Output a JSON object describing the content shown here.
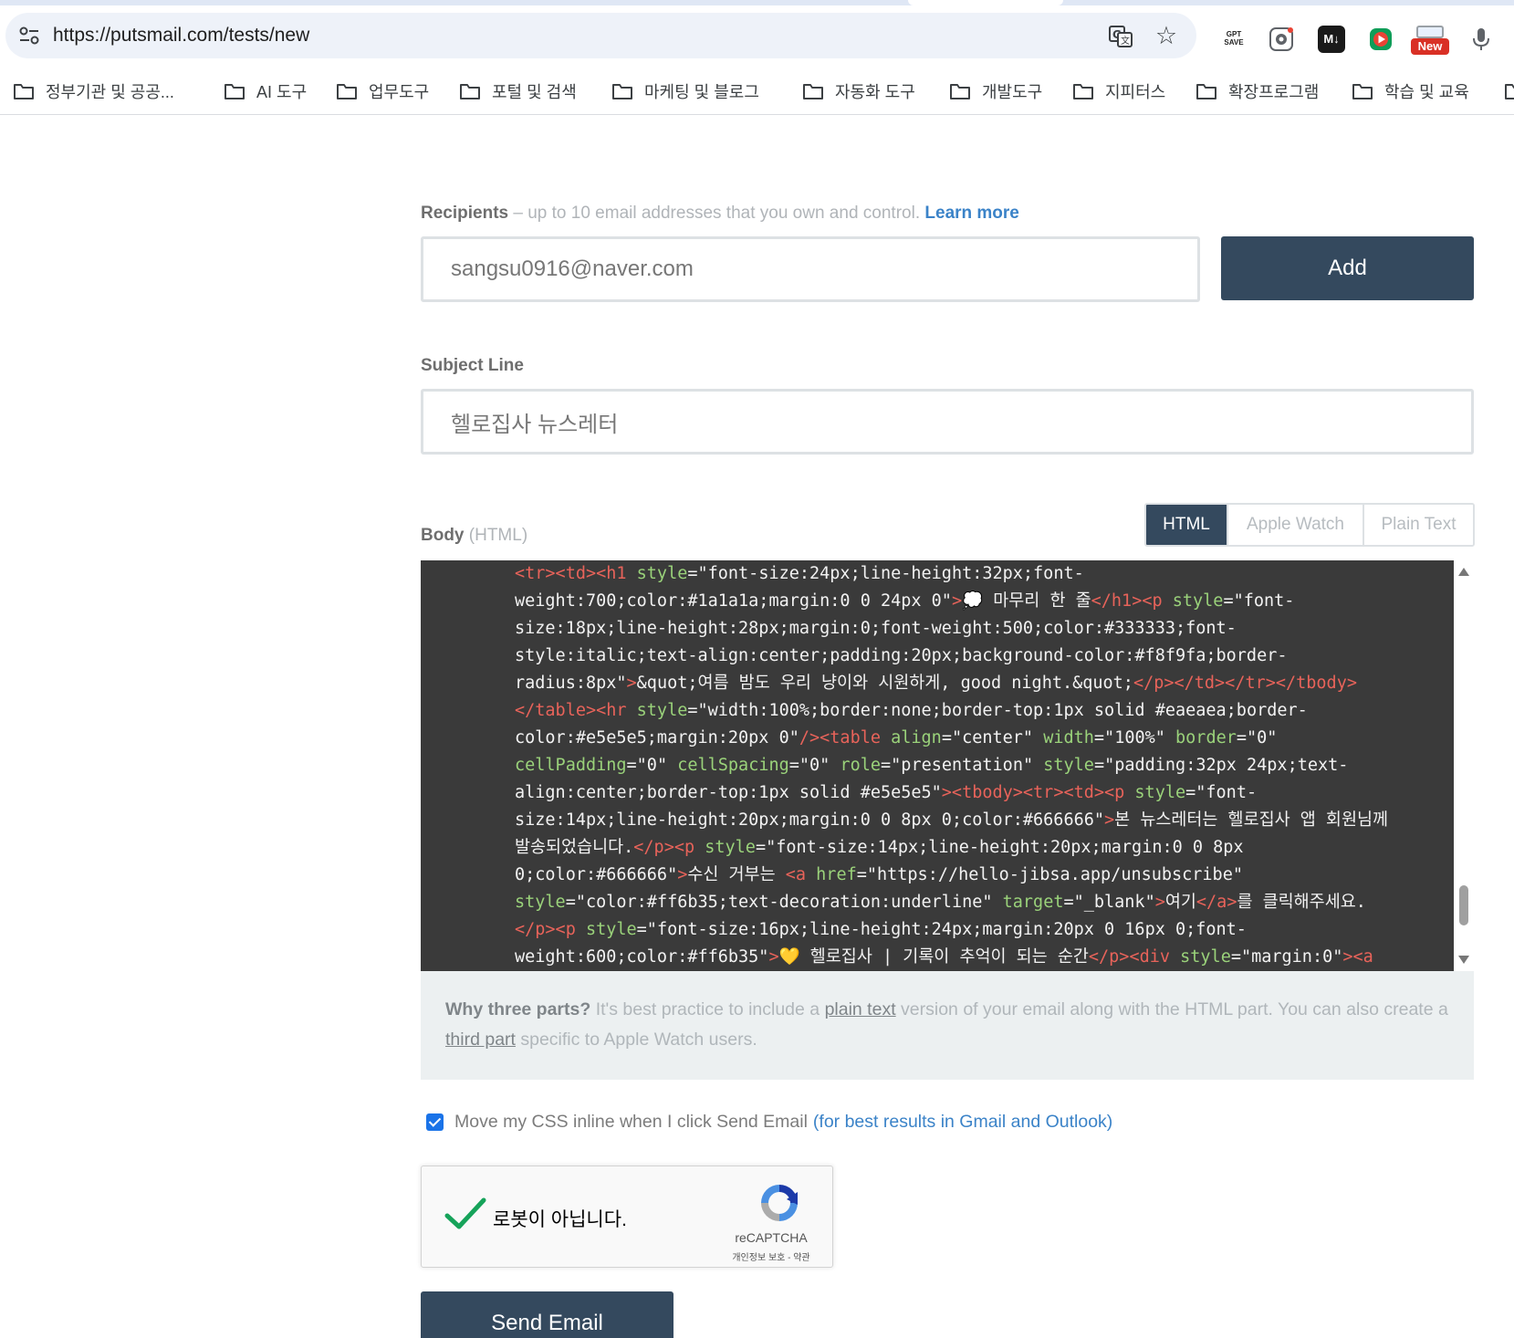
{
  "browser": {
    "url": "https://putsmail.com/tests/new",
    "extensions": {
      "gpt_save": "GPT SAVE",
      "markdown": "M↓",
      "new_badge": "New"
    },
    "bookmarks": [
      {
        "label": "정부기관 및 공공..."
      },
      {
        "label": "AI 도구"
      },
      {
        "label": "업무도구"
      },
      {
        "label": "포털 및 검색"
      },
      {
        "label": "마케팅 및 블로그"
      },
      {
        "label": "자동화 도구"
      },
      {
        "label": "개발도구"
      },
      {
        "label": "지피터스"
      },
      {
        "label": "확장프로그램"
      },
      {
        "label": "학습 및 교육"
      }
    ]
  },
  "form": {
    "recipients": {
      "label": "Recipients",
      "hint": "– up to 10 email addresses that you own and control.",
      "learn_more": "Learn more",
      "value": "sangsu0916@naver.com",
      "add_button": "Add"
    },
    "subject": {
      "label": "Subject Line",
      "value": "헬로집사 뉴스레터"
    },
    "body": {
      "label": "Body",
      "mode_label": "(HTML)",
      "tabs": [
        {
          "label": "HTML",
          "active": true
        },
        {
          "label": "Apple Watch",
          "active": false
        },
        {
          "label": "Plain Text",
          "active": false
        }
      ],
      "code_lines": [
        [
          [
            "t",
            "<tr><td><h1 "
          ],
          [
            "a",
            "style"
          ],
          [
            "v",
            "=\"font-size:24px;line-height:32px;font-"
          ]
        ],
        [
          [
            "v",
            "weight:700;color:#1a1a1a;margin:0 0 24px 0\""
          ],
          [
            "t",
            ">"
          ],
          [
            "x",
            "💭 마무리 한 줄"
          ],
          [
            "t",
            "</h1><p "
          ],
          [
            "a",
            "style"
          ],
          [
            "v",
            "=\"font-"
          ]
        ],
        [
          [
            "v",
            "size:18px;line-height:28px;margin:0;font-weight:500;color:#333333;font-"
          ]
        ],
        [
          [
            "v",
            "style:italic;text-align:center;padding:20px;background-color:#f8f9fa;border-"
          ]
        ],
        [
          [
            "v",
            "radius:8px\""
          ],
          [
            "t",
            ">"
          ],
          [
            "x",
            "&quot;여름 밤도 우리 냥이와 시원하게, good night.&quot;"
          ],
          [
            "t",
            "</p></td></tr></tbody>"
          ]
        ],
        [
          [
            "t",
            "</table><hr "
          ],
          [
            "a",
            "style"
          ],
          [
            "v",
            "=\"width:100%;border:none;border-top:1px solid #eaeaea;border-"
          ]
        ],
        [
          [
            "v",
            "color:#e5e5e5;margin:20px 0\""
          ],
          [
            "t",
            "/><table "
          ],
          [
            "a",
            "align"
          ],
          [
            "v",
            "=\"center\" "
          ],
          [
            "a",
            "width"
          ],
          [
            "v",
            "=\"100%\" "
          ],
          [
            "a",
            "border"
          ],
          [
            "v",
            "=\"0\""
          ]
        ],
        [
          [
            "a",
            "cellPadding"
          ],
          [
            "v",
            "=\"0\" "
          ],
          [
            "a",
            "cellSpacing"
          ],
          [
            "v",
            "=\"0\" "
          ],
          [
            "a",
            "role"
          ],
          [
            "v",
            "=\"presentation\" "
          ],
          [
            "a",
            "style"
          ],
          [
            "v",
            "=\"padding:32px 24px;text-"
          ]
        ],
        [
          [
            "v",
            "align:center;border-top:1px solid #e5e5e5\""
          ],
          [
            "t",
            "><tbody><tr><td><p "
          ],
          [
            "a",
            "style"
          ],
          [
            "v",
            "=\"font-"
          ]
        ],
        [
          [
            "v",
            "size:14px;line-height:20px;margin:0 0 8px 0;color:#666666\""
          ],
          [
            "t",
            ">"
          ],
          [
            "x",
            "본 뉴스레터는 헬로집사 앱 회원님께"
          ]
        ],
        [
          [
            "x",
            "발송되었습니다."
          ],
          [
            "t",
            "</p><p "
          ],
          [
            "a",
            "style"
          ],
          [
            "v",
            "=\"font-size:14px;line-height:20px;margin:0 0 8px"
          ]
        ],
        [
          [
            "v",
            "0;color:#666666\""
          ],
          [
            "t",
            ">"
          ],
          [
            "x",
            "수신 거부는 "
          ],
          [
            "t",
            "<a "
          ],
          [
            "a",
            "href"
          ],
          [
            "v",
            "=\"https://hello-jibsa.app/unsubscribe\""
          ]
        ],
        [
          [
            "a",
            "style"
          ],
          [
            "v",
            "=\"color:#ff6b35;text-decoration:underline\" "
          ],
          [
            "a",
            "target"
          ],
          [
            "v",
            "=\"_blank\""
          ],
          [
            "t",
            ">"
          ],
          [
            "x",
            "여기"
          ],
          [
            "t",
            "</a>"
          ],
          [
            "x",
            "를 클릭해주세요."
          ]
        ],
        [
          [
            "t",
            "</p><p "
          ],
          [
            "a",
            "style"
          ],
          [
            "v",
            "=\"font-size:16px;line-height:24px;margin:20px 0 16px 0;font-"
          ]
        ],
        [
          [
            "v",
            "weight:600;color:#ff6b35\""
          ],
          [
            "t",
            ">"
          ],
          [
            "x",
            "💛 헬로집사 | 기록이 추억이 되는 순간"
          ],
          [
            "t",
            "</p><div "
          ],
          [
            "a",
            "style"
          ],
          [
            "v",
            "=\"margin:0\""
          ],
          [
            "t",
            "><a"
          ]
        ]
      ]
    },
    "notice": {
      "lead": "Why three parts?",
      "text1": " It's best practice to include a ",
      "link1": "plain text",
      "text2": " version of your email along with the HTML part. You can also create a ",
      "link2": "third part",
      "text3": " specific to Apple Watch users."
    },
    "inline_css": {
      "checked": true,
      "label": "Move my CSS inline when I click Send Email",
      "hint": "(for best results in Gmail and Outlook)"
    },
    "recaptcha": {
      "label": "로봇이 아닙니다.",
      "brand": "reCAPTCHA",
      "privacy": "개인정보 보호",
      "separator": " - ",
      "terms": "약관"
    },
    "send_button": "Send Email"
  },
  "colors": {
    "primary_button": "#34495e",
    "link": "#3b83c8",
    "code_bg": "#3a3a3a",
    "code_tag": "#e8635a",
    "code_attr": "#9ad27a"
  }
}
